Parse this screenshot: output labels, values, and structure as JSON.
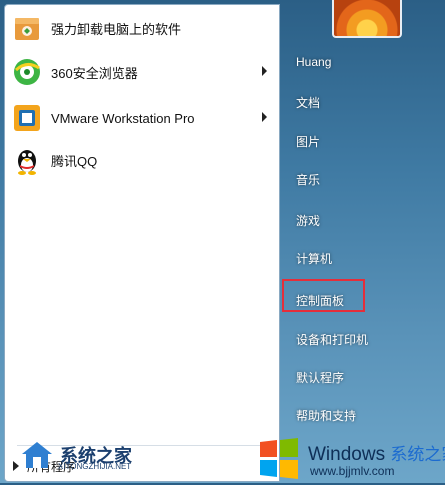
{
  "programs": [
    {
      "label": "强力卸载电脑上的软件",
      "has_submenu": false,
      "icon": "uninstall-box-icon"
    },
    {
      "label": "360安全浏览器",
      "has_submenu": true,
      "icon": "360-browser-icon"
    },
    {
      "label": "VMware Workstation Pro",
      "has_submenu": true,
      "icon": "vmware-icon"
    },
    {
      "label": "腾讯QQ",
      "has_submenu": false,
      "icon": "qq-penguin-icon"
    }
  ],
  "all_programs_label": "所有程序",
  "right_menu": [
    {
      "key": "huang",
      "label": "Huang"
    },
    {
      "key": "documents",
      "label": "文档"
    },
    {
      "key": "pictures",
      "label": "图片"
    },
    {
      "key": "music",
      "label": "音乐"
    },
    {
      "key": "games",
      "label": "游戏"
    },
    {
      "key": "computer",
      "label": "计算机"
    },
    {
      "key": "control-panel",
      "label": "控制面板"
    },
    {
      "key": "devices-printers",
      "label": "设备和打印机"
    },
    {
      "key": "default-programs",
      "label": "默认程序"
    },
    {
      "key": "help-support",
      "label": "帮助和支持"
    }
  ],
  "watermark_left": {
    "title": "系统之家",
    "url": "XITONGZHIJIA.NET"
  },
  "watermark_right": {
    "brand": "Windows",
    "cn": "系统之家",
    "url": "www.bjjmlv.com"
  },
  "colors": {
    "highlight": "#e52e3a",
    "accent": "#1c6bd0"
  }
}
